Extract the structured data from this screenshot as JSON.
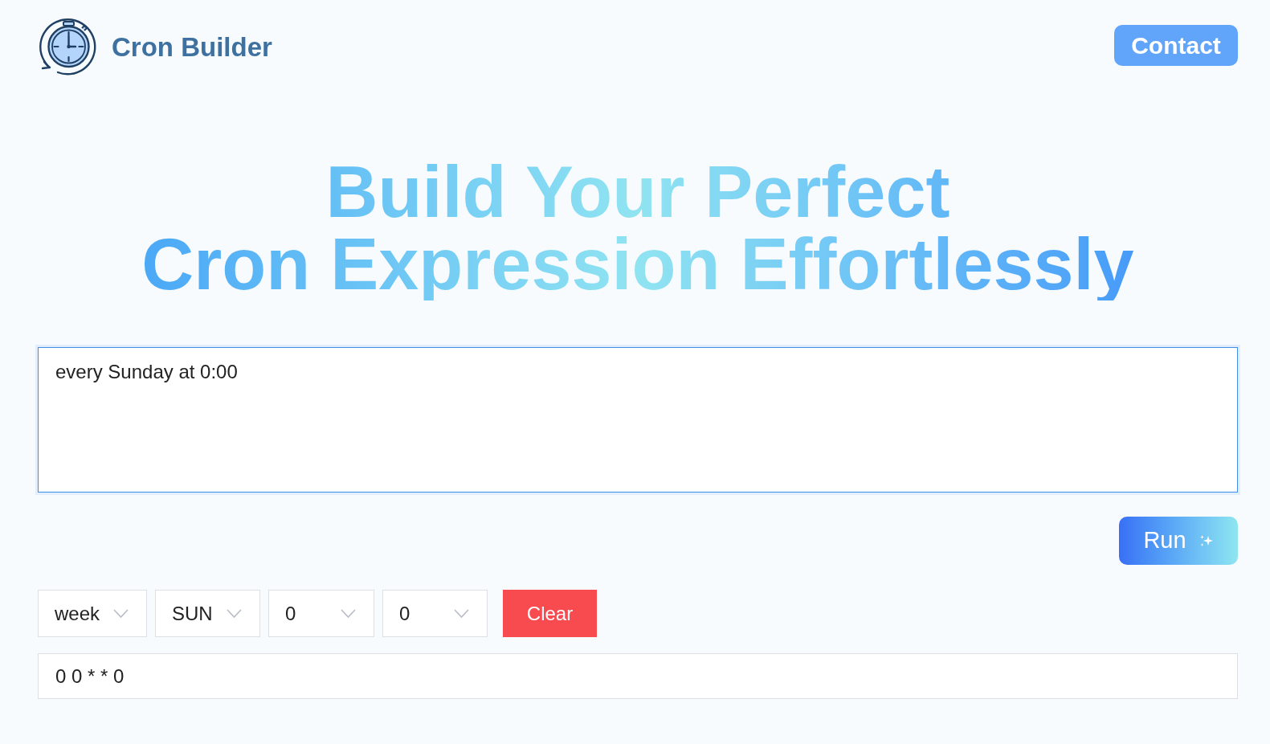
{
  "header": {
    "logo_text": "Cron Builder",
    "contact_button": "Contact"
  },
  "hero": {
    "title_lines": [
      "Build Your Perfect",
      "Cron Expression Effortlessly"
    ]
  },
  "description_input": {
    "value": "every Sunday at 0:00",
    "focused": true
  },
  "run_button": {
    "label": "Run"
  },
  "selectors": [
    {
      "value": "week"
    },
    {
      "value": "SUN"
    },
    {
      "value": "0"
    },
    {
      "value": "0"
    }
  ],
  "clear_button": {
    "label": "Clear"
  },
  "result": {
    "value": "0 0 * * 0"
  }
}
